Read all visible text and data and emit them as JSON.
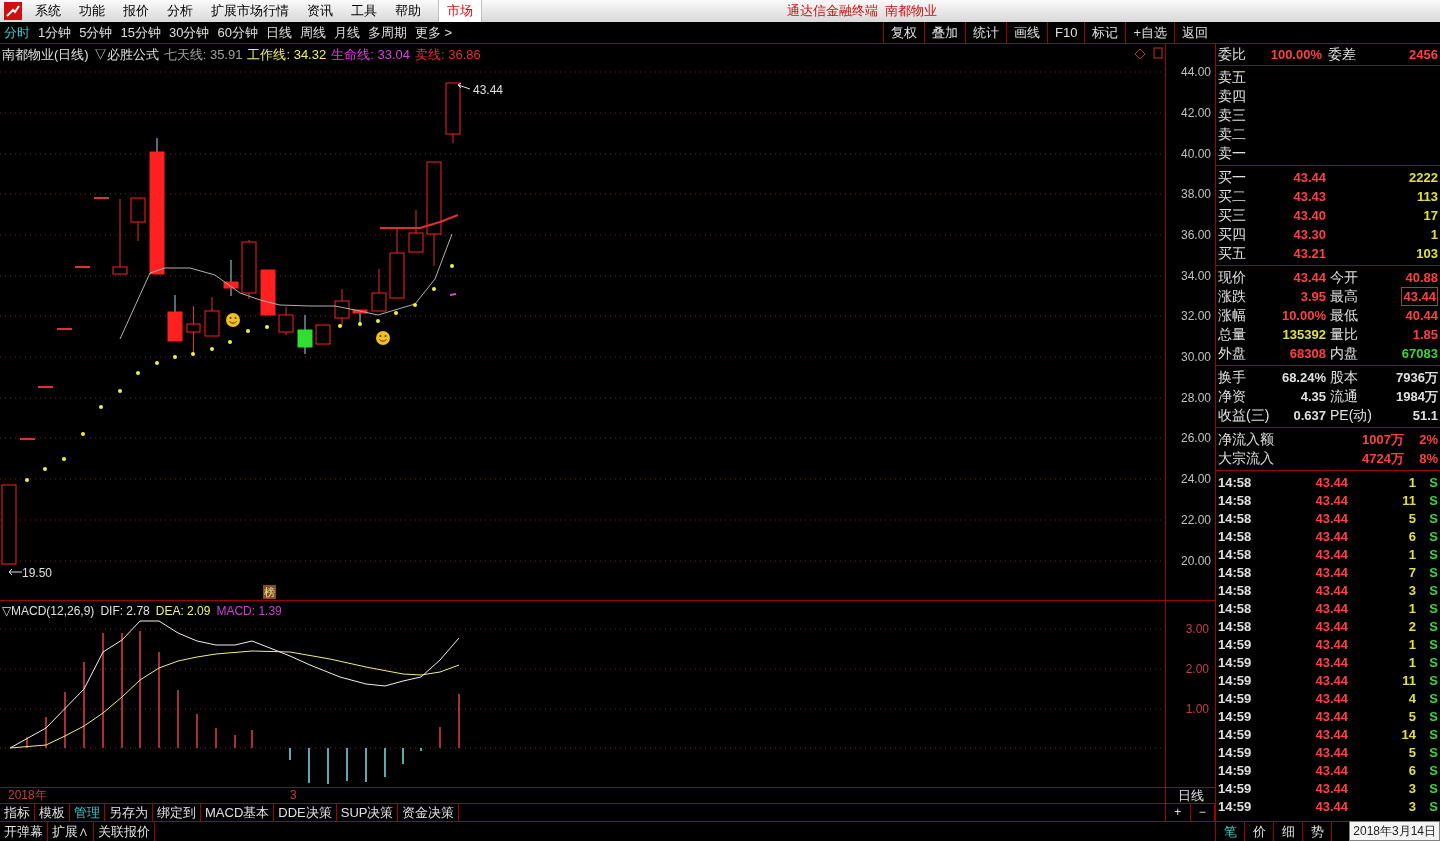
{
  "menu_bar": {
    "items": [
      "系统",
      "功能",
      "报价",
      "分析",
      "扩展市场行情",
      "资讯",
      "工具",
      "帮助"
    ],
    "market_button": "市场",
    "title": "通达信金融终端  南都物业"
  },
  "period_tabs": [
    {
      "label": "分时",
      "selected": true
    },
    {
      "label": "1分钟",
      "selected": false
    },
    {
      "label": "5分钟",
      "selected": false
    },
    {
      "label": "15分钟",
      "selected": false
    },
    {
      "label": "30分钟",
      "selected": false
    },
    {
      "label": "60分钟",
      "selected": false
    },
    {
      "label": "日线",
      "selected": false
    },
    {
      "label": "周线",
      "selected": false
    },
    {
      "label": "月线",
      "selected": false
    },
    {
      "label": "多周期",
      "selected": false
    },
    {
      "label": "更多 >",
      "selected": false
    }
  ],
  "toolbar_buttons": [
    "复权",
    "叠加",
    "统计",
    "画线",
    "F10",
    "标记",
    "+自选",
    "返回"
  ],
  "chart_header": {
    "title": "南都物业(日线)",
    "formula": "▽必胜公式",
    "lines": [
      {
        "text": "七天线: 35.91",
        "color": "#a0a0a0"
      },
      {
        "text": "工作线: 34.32",
        "color": "#f0f060"
      },
      {
        "text": "生命线: 33.04",
        "color": "#e040e0"
      },
      {
        "text": "卖线: 36.86",
        "color": "#e03030"
      }
    ]
  },
  "price_axis": {
    "ticks": [
      "44.00",
      "42.00",
      "40.00",
      "38.00",
      "36.00",
      "34.00",
      "32.00",
      "30.00",
      "28.00",
      "26.00",
      "24.00",
      "22.00",
      "20.00"
    ],
    "high_label": "43.44",
    "low_label": "19.50"
  },
  "badge": "榜",
  "macd": {
    "title": "▽MACD(12,26,9)",
    "values": [
      {
        "text": "DIF: 2.78",
        "color": "#e0e0e0"
      },
      {
        "text": "DEA: 2.09",
        "color": "#f0f080"
      },
      {
        "text": "MACD: 1.39",
        "color": "#d040d0"
      }
    ],
    "ticks": [
      "3.00",
      "2.00",
      "1.00"
    ]
  },
  "date_axis": [
    "2018年",
    "3"
  ],
  "period_label": "日线",
  "zoom_buttons": [
    "+",
    "−"
  ],
  "indicator_tabs": [
    {
      "label": "指标",
      "selected": false
    },
    {
      "label": "模板",
      "selected": false
    },
    {
      "label": "管理",
      "selected": true
    },
    {
      "label": "另存为",
      "selected": false
    },
    {
      "label": "绑定到",
      "selected": false
    },
    {
      "label": "MACD基本",
      "selected": false
    },
    {
      "label": "DDE决策",
      "selected": false
    },
    {
      "label": "SUP决策",
      "selected": false
    },
    {
      "label": "资金决策",
      "selected": false
    }
  ],
  "extra_tabs": [
    "开弹幕",
    "扩展∧",
    "关联报价"
  ],
  "order_ratio": {
    "label": "委比",
    "value": "100.00%",
    "label2": "委差",
    "value2": "2456"
  },
  "asks": [
    {
      "label": "卖五"
    },
    {
      "label": "卖四"
    },
    {
      "label": "卖三"
    },
    {
      "label": "卖二"
    },
    {
      "label": "卖一"
    }
  ],
  "bids": [
    {
      "label": "买一",
      "price": "43.44",
      "volume": "2222"
    },
    {
      "label": "买二",
      "price": "43.43",
      "volume": "113"
    },
    {
      "label": "买三",
      "price": "43.40",
      "volume": "17"
    },
    {
      "label": "买四",
      "price": "43.30",
      "volume": "1"
    },
    {
      "label": "买五",
      "price": "43.21",
      "volume": "103"
    }
  ],
  "stat_sections": [
    {
      "cells": [
        {
          "label": "现价",
          "value": "43.44",
          "color": "#ff4040",
          "boxed": false
        },
        {
          "label": "今开",
          "value": "40.88",
          "color": "#ff4040",
          "boxed": false
        },
        {
          "label": "涨跌",
          "value": "3.95",
          "color": "#ff4040",
          "boxed": false
        },
        {
          "label": "最高",
          "value": "43.44",
          "color": "#ff4040",
          "boxed": true
        },
        {
          "label": "涨幅",
          "value": "10.00%",
          "color": "#ff4040",
          "boxed": false
        },
        {
          "label": "最低",
          "value": "40.44",
          "color": "#ff4040",
          "boxed": false
        },
        {
          "label": "总量",
          "value": "135392",
          "color": "#e0e040",
          "boxed": false
        },
        {
          "label": "量比",
          "value": "1.85",
          "color": "#ff4040",
          "boxed": false
        },
        {
          "label": "外盘",
          "value": "68308",
          "color": "#ff4040",
          "boxed": false
        },
        {
          "label": "内盘",
          "value": "67083",
          "color": "#40d040",
          "boxed": false
        }
      ]
    },
    {
      "cells": [
        {
          "label": "换手",
          "value": "68.24%",
          "color": "#e0e0e0",
          "boxed": false
        },
        {
          "label": "股本",
          "value": "7936万",
          "color": "#e0e0e0",
          "boxed": false
        },
        {
          "label": "净资",
          "value": "4.35",
          "color": "#e0e0e0",
          "boxed": false
        },
        {
          "label": "流通",
          "value": "1984万",
          "color": "#e0e0e0",
          "boxed": false
        },
        {
          "label": "收益(三)",
          "value": "0.637",
          "color": "#e0e0e0",
          "boxed": false
        },
        {
          "label": "PE(动)",
          "value": "51.1",
          "color": "#e0e0e0",
          "boxed": false
        }
      ]
    }
  ],
  "flows": [
    {
      "label": "净流入额",
      "amount": "1007万",
      "pct": "2%"
    },
    {
      "label": "大宗流入",
      "amount": "4724万",
      "pct": "8%"
    }
  ],
  "trades": [
    {
      "time": "14:58",
      "price": "43.44",
      "volume": "1",
      "side": "S"
    },
    {
      "time": "14:58",
      "price": "43.44",
      "volume": "11",
      "side": "S"
    },
    {
      "time": "14:58",
      "price": "43.44",
      "volume": "5",
      "side": "S"
    },
    {
      "time": "14:58",
      "price": "43.44",
      "volume": "6",
      "side": "S"
    },
    {
      "time": "14:58",
      "price": "43.44",
      "volume": "1",
      "side": "S"
    },
    {
      "time": "14:58",
      "price": "43.44",
      "volume": "7",
      "side": "S"
    },
    {
      "time": "14:58",
      "price": "43.44",
      "volume": "3",
      "side": "S"
    },
    {
      "time": "14:58",
      "price": "43.44",
      "volume": "1",
      "side": "S"
    },
    {
      "time": "14:58",
      "price": "43.44",
      "volume": "2",
      "side": "S"
    },
    {
      "time": "14:59",
      "price": "43.44",
      "volume": "1",
      "side": "S"
    },
    {
      "time": "14:59",
      "price": "43.44",
      "volume": "1",
      "side": "S"
    },
    {
      "time": "14:59",
      "price": "43.44",
      "volume": "11",
      "side": "S"
    },
    {
      "time": "14:59",
      "price": "43.44",
      "volume": "4",
      "side": "S"
    },
    {
      "time": "14:59",
      "price": "43.44",
      "volume": "5",
      "side": "S"
    },
    {
      "time": "14:59",
      "price": "43.44",
      "volume": "14",
      "side": "S"
    },
    {
      "time": "14:59",
      "price": "43.44",
      "volume": "5",
      "side": "S"
    },
    {
      "time": "14:59",
      "price": "43.44",
      "volume": "6",
      "side": "S"
    },
    {
      "time": "14:59",
      "price": "43.44",
      "volume": "3",
      "side": "S"
    },
    {
      "time": "14:59",
      "price": "43.44",
      "volume": "3",
      "side": "S"
    }
  ],
  "bottom_tabs": [
    {
      "label": "笔",
      "selected": true
    },
    {
      "label": "价",
      "selected": false
    },
    {
      "label": "细",
      "selected": false
    },
    {
      "label": "势",
      "selected": false
    }
  ],
  "tooltip": "2018年3月14日"
}
